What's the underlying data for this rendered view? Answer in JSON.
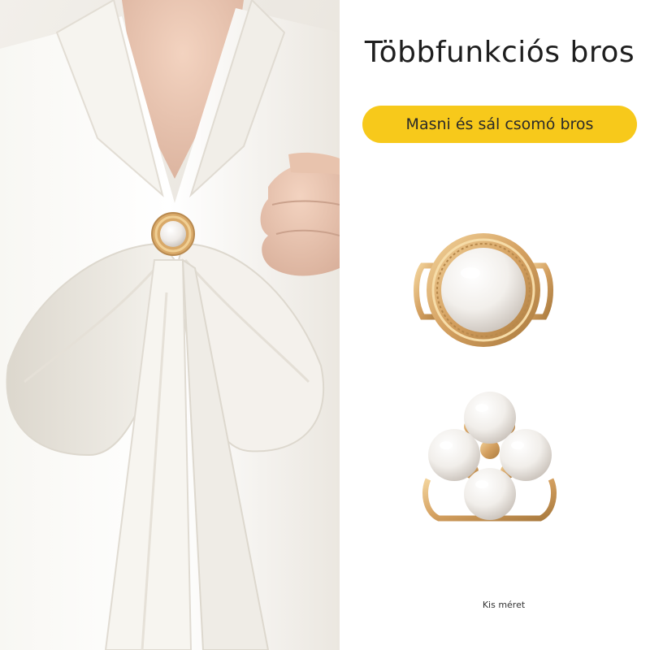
{
  "header": {
    "title": "Többfunkciós bros"
  },
  "badge": {
    "label": "Masni és sál csomó bros"
  },
  "products": {
    "caption": "Kis méret"
  },
  "icons": {
    "model": "model-photo-icon",
    "single": "single-pearl-brooch-icon",
    "cluster": "four-pearl-brooch-icon"
  },
  "colors": {
    "accent": "#f7c91b",
    "gold": "#d9a968",
    "pearl": "#f3f1ee"
  }
}
